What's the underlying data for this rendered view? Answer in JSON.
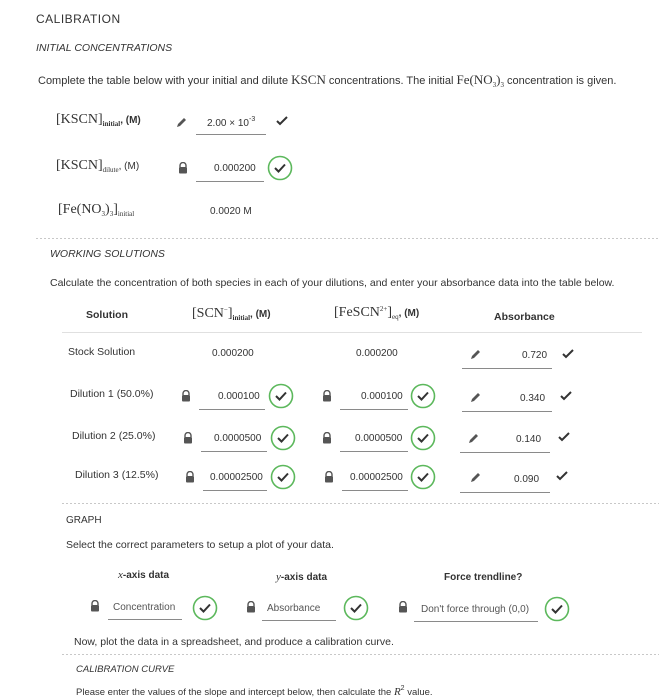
{
  "section_title": "CALIBRATION",
  "initial": {
    "heading": "INITIAL CONCENTRATIONS",
    "instructions_pre": "Complete the table below with your initial and dilute ",
    "instructions_mid": " concentrations. The initial ",
    "instructions_post": " concentration is given.",
    "kscn_text": "KSCN",
    "feno3_text": "Fe(NO",
    "rows": [
      {
        "label_main": "[KSCN]",
        "label_sub": "initial",
        "label_unit": ", (M)",
        "value": "2.00 × 10",
        "value_exp": "-3",
        "editable": true
      },
      {
        "label_main": "[KSCN]",
        "label_sub": "dilute",
        "label_unit": ", (M)",
        "value": "0.000200",
        "locked": true
      },
      {
        "label_main": "[Fe(NO",
        "label_sub": "initial",
        "label_unit": "",
        "value": "0.0020 M"
      }
    ]
  },
  "working": {
    "heading": "WORKING SOLUTIONS",
    "instructions": "Calculate the concentration of both species in each of your dilutions, and enter your absorbance data into the table below.",
    "col_solution": "Solution",
    "col_scn": "[SCN",
    "col_scn_sub": "initial",
    "col_scn_unit": ", (M)",
    "col_fescn": "[FeSCN",
    "col_fescn_sup": "2+",
    "col_fescn_sub": "eq",
    "col_fescn_unit": ", (M)",
    "col_absorbance": "Absorbance",
    "rows": [
      {
        "solution": "Stock Solution",
        "scn": "0.000200",
        "fescn": "0.000200",
        "absorbance": "0.720"
      },
      {
        "solution": "Dilution 1 (50.0%)",
        "scn": "0.000100",
        "fescn": "0.000100",
        "absorbance": "0.340"
      },
      {
        "solution": "Dilution 2 (25.0%)",
        "scn": "0.0000500",
        "fescn": "0.0000500",
        "absorbance": "0.140"
      },
      {
        "solution": "Dilution 3 (12.5%)",
        "scn": "0.00002500",
        "fescn": "0.00002500",
        "absorbance": "0.090"
      }
    ]
  },
  "graph": {
    "heading": "GRAPH",
    "instructions": "Select the correct parameters to setup a plot of your data.",
    "x_label": "x-axis data",
    "y_label": "y-axis data",
    "trend_label": "Force trendline?",
    "x_value": "Concentration",
    "y_value": "Absorbance",
    "trend_value": "Don't force through (0,0)",
    "note": "Now, plot the data in a spreadsheet, and produce a calibration curve."
  },
  "curve": {
    "heading": "CALIBRATION CURVE",
    "instructions_pre": "Please enter the values of the slope and intercept below, then calculate the ",
    "instructions_post": " value."
  },
  "colors": {
    "check_green": "#5cb85c",
    "text": "#333333",
    "sep": "#c8c8c8"
  }
}
